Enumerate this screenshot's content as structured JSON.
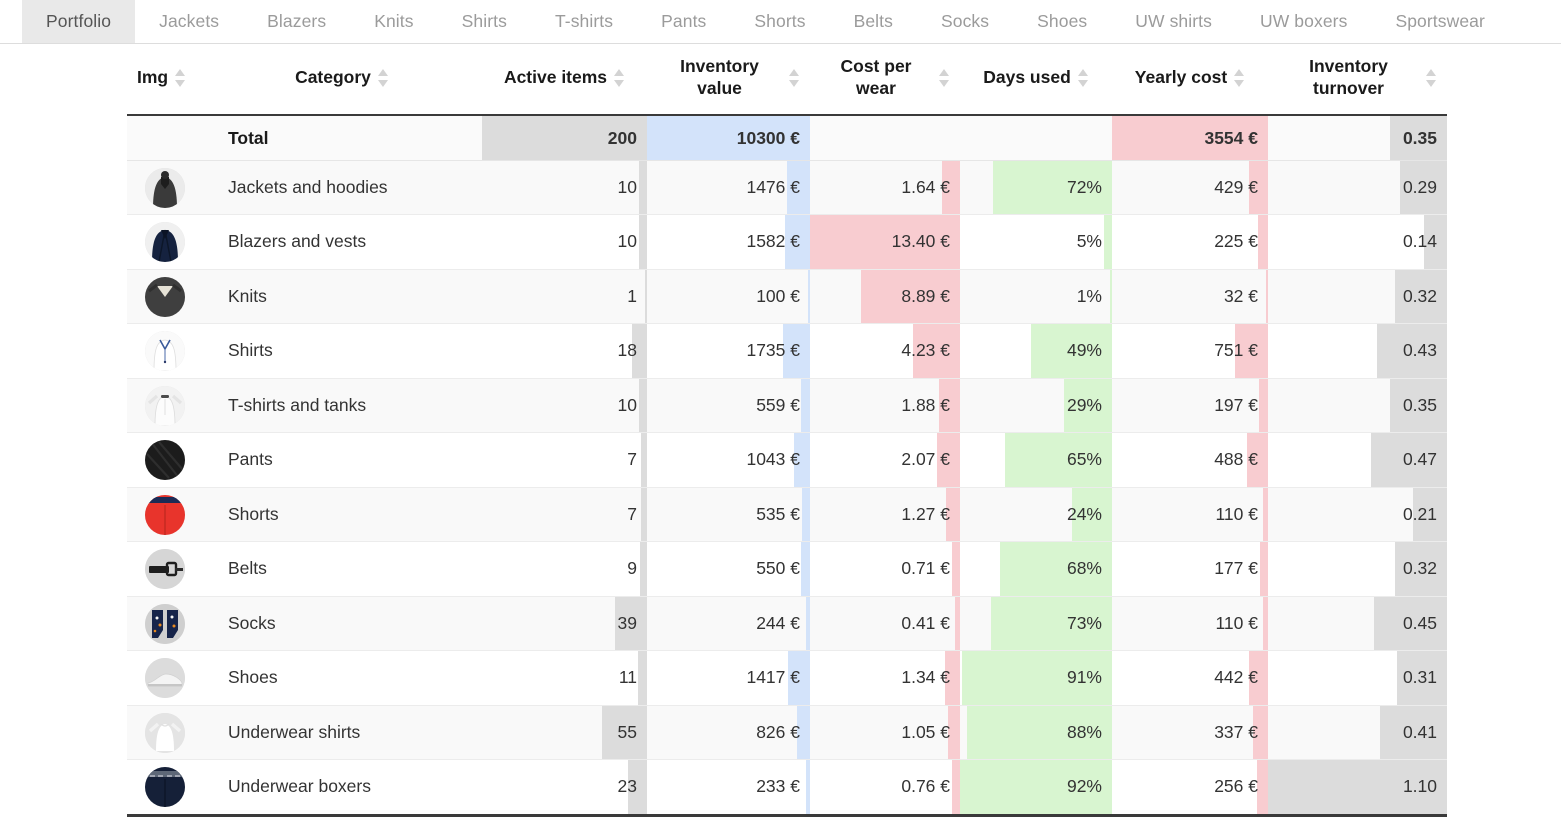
{
  "tabs": [
    {
      "label": "Portfolio",
      "active": true
    },
    {
      "label": "Jackets",
      "active": false
    },
    {
      "label": "Blazers",
      "active": false
    },
    {
      "label": "Knits",
      "active": false
    },
    {
      "label": "Shirts",
      "active": false
    },
    {
      "label": "T-shirts",
      "active": false
    },
    {
      "label": "Pants",
      "active": false
    },
    {
      "label": "Shorts",
      "active": false
    },
    {
      "label": "Belts",
      "active": false
    },
    {
      "label": "Socks",
      "active": false
    },
    {
      "label": "Shoes",
      "active": false
    },
    {
      "label": "UW shirts",
      "active": false
    },
    {
      "label": "UW boxers",
      "active": false
    },
    {
      "label": "Sportswear",
      "active": false
    }
  ],
  "colors": {
    "bar_gray": "#dcdcdc",
    "bar_blue": "#d3e3fa",
    "bar_pink": "#f8ccd0",
    "bar_green": "#d8f5d0",
    "active_tab_bg": "#e9e9e9",
    "row_alt_bg": "#f9f9f9",
    "header_rule": "#3a3a3a"
  },
  "table": {
    "columns": [
      {
        "key": "img",
        "label": "Img",
        "sortable": true,
        "align": "left"
      },
      {
        "key": "category",
        "label": "Category",
        "sortable": true,
        "align": "center"
      },
      {
        "key": "active",
        "label": "Active items",
        "sortable": true,
        "align": "center"
      },
      {
        "key": "value",
        "label": "Inventory value",
        "sortable": true,
        "align": "center"
      },
      {
        "key": "cpw",
        "label": "Cost per wear",
        "sortable": true,
        "align": "center"
      },
      {
        "key": "days",
        "label": "Days used",
        "sortable": true,
        "align": "center"
      },
      {
        "key": "yearly",
        "label": "Yearly cost",
        "sortable": true,
        "align": "center"
      },
      {
        "key": "turnover",
        "label": "Inventory turnover",
        "sortable": true,
        "align": "center"
      }
    ],
    "total_row": {
      "category": "Total",
      "active": "200",
      "value": "10300 €",
      "cpw": "",
      "days": "",
      "yearly": "3554 €",
      "turnover": "0.35"
    },
    "rows": [
      {
        "icon": "jacket-thumb",
        "category": "Jackets and hoodies",
        "active": "10",
        "value": "1476 €",
        "cpw": "1.64 €",
        "days": "72%",
        "yearly": "429 €",
        "turnover": "0.29"
      },
      {
        "icon": "blazer-thumb",
        "category": "Blazers and vests",
        "active": "10",
        "value": "1582 €",
        "cpw": "13.40 €",
        "days": "5%",
        "yearly": "225 €",
        "turnover": "0.14"
      },
      {
        "icon": "knit-thumb",
        "category": "Knits",
        "active": "1",
        "value": "100 €",
        "cpw": "8.89 €",
        "days": "1%",
        "yearly": "32 €",
        "turnover": "0.32"
      },
      {
        "icon": "shirt-thumb",
        "category": "Shirts",
        "active": "18",
        "value": "1735 €",
        "cpw": "4.23 €",
        "days": "49%",
        "yearly": "751 €",
        "turnover": "0.43"
      },
      {
        "icon": "tshirt-thumb",
        "category": "T-shirts and tanks",
        "active": "10",
        "value": "559 €",
        "cpw": "1.88 €",
        "days": "29%",
        "yearly": "197 €",
        "turnover": "0.35"
      },
      {
        "icon": "pants-thumb",
        "category": "Pants",
        "active": "7",
        "value": "1043 €",
        "cpw": "2.07 €",
        "days": "65%",
        "yearly": "488 €",
        "turnover": "0.47"
      },
      {
        "icon": "shorts-thumb",
        "category": "Shorts",
        "active": "7",
        "value": "535 €",
        "cpw": "1.27 €",
        "days": "24%",
        "yearly": "110 €",
        "turnover": "0.21"
      },
      {
        "icon": "belt-thumb",
        "category": "Belts",
        "active": "9",
        "value": "550 €",
        "cpw": "0.71 €",
        "days": "68%",
        "yearly": "177 €",
        "turnover": "0.32"
      },
      {
        "icon": "socks-thumb",
        "category": "Socks",
        "active": "39",
        "value": "244 €",
        "cpw": "0.41 €",
        "days": "73%",
        "yearly": "110 €",
        "turnover": "0.45"
      },
      {
        "icon": "shoe-thumb",
        "category": "Shoes",
        "active": "11",
        "value": "1417 €",
        "cpw": "1.34 €",
        "days": "91%",
        "yearly": "442 €",
        "turnover": "0.31"
      },
      {
        "icon": "undershirt-thumb",
        "category": "Underwear shirts",
        "active": "55",
        "value": "826 €",
        "cpw": "1.05 €",
        "days": "88%",
        "yearly": "337 €",
        "turnover": "0.41"
      },
      {
        "icon": "boxers-thumb",
        "category": "Underwear boxers",
        "active": "23",
        "value": "233 €",
        "cpw": "0.76 €",
        "days": "92%",
        "yearly": "256 €",
        "turnover": "1.10"
      }
    ]
  },
  "chart_data": {
    "type": "table",
    "title": "Portfolio",
    "categories": [
      "Jackets and hoodies",
      "Blazers and vests",
      "Knits",
      "Shirts",
      "T-shirts and tanks",
      "Pants",
      "Shorts",
      "Belts",
      "Socks",
      "Shoes",
      "Underwear shirts",
      "Underwear boxers"
    ],
    "series": [
      {
        "name": "Active items",
        "unit": "",
        "values": [
          10,
          10,
          1,
          18,
          10,
          7,
          7,
          9,
          39,
          11,
          55,
          23
        ],
        "total": 200,
        "bar_color": "#dcdcdc"
      },
      {
        "name": "Inventory value",
        "unit": "€",
        "values": [
          1476,
          1582,
          100,
          1735,
          559,
          1043,
          535,
          550,
          244,
          1417,
          826,
          233
        ],
        "total": 10300,
        "bar_color": "#d3e3fa"
      },
      {
        "name": "Cost per wear",
        "unit": "€",
        "values": [
          1.64,
          13.4,
          8.89,
          4.23,
          1.88,
          2.07,
          1.27,
          0.71,
          0.41,
          1.34,
          1.05,
          0.76
        ],
        "total": null,
        "bar_color": "#f8ccd0"
      },
      {
        "name": "Days used",
        "unit": "%",
        "values": [
          72,
          5,
          1,
          49,
          29,
          65,
          24,
          68,
          73,
          91,
          88,
          92
        ],
        "total": null,
        "bar_color": "#d8f5d0"
      },
      {
        "name": "Yearly cost",
        "unit": "€",
        "values": [
          429,
          225,
          32,
          751,
          197,
          488,
          110,
          177,
          110,
          442,
          337,
          256
        ],
        "total": 3554,
        "bar_color": "#f8ccd0"
      },
      {
        "name": "Inventory turnover",
        "unit": "",
        "values": [
          0.29,
          0.14,
          0.32,
          0.43,
          0.35,
          0.47,
          0.21,
          0.32,
          0.45,
          0.31,
          0.41,
          1.1
        ],
        "total": 0.35,
        "bar_color": "#dcdcdc"
      }
    ]
  }
}
